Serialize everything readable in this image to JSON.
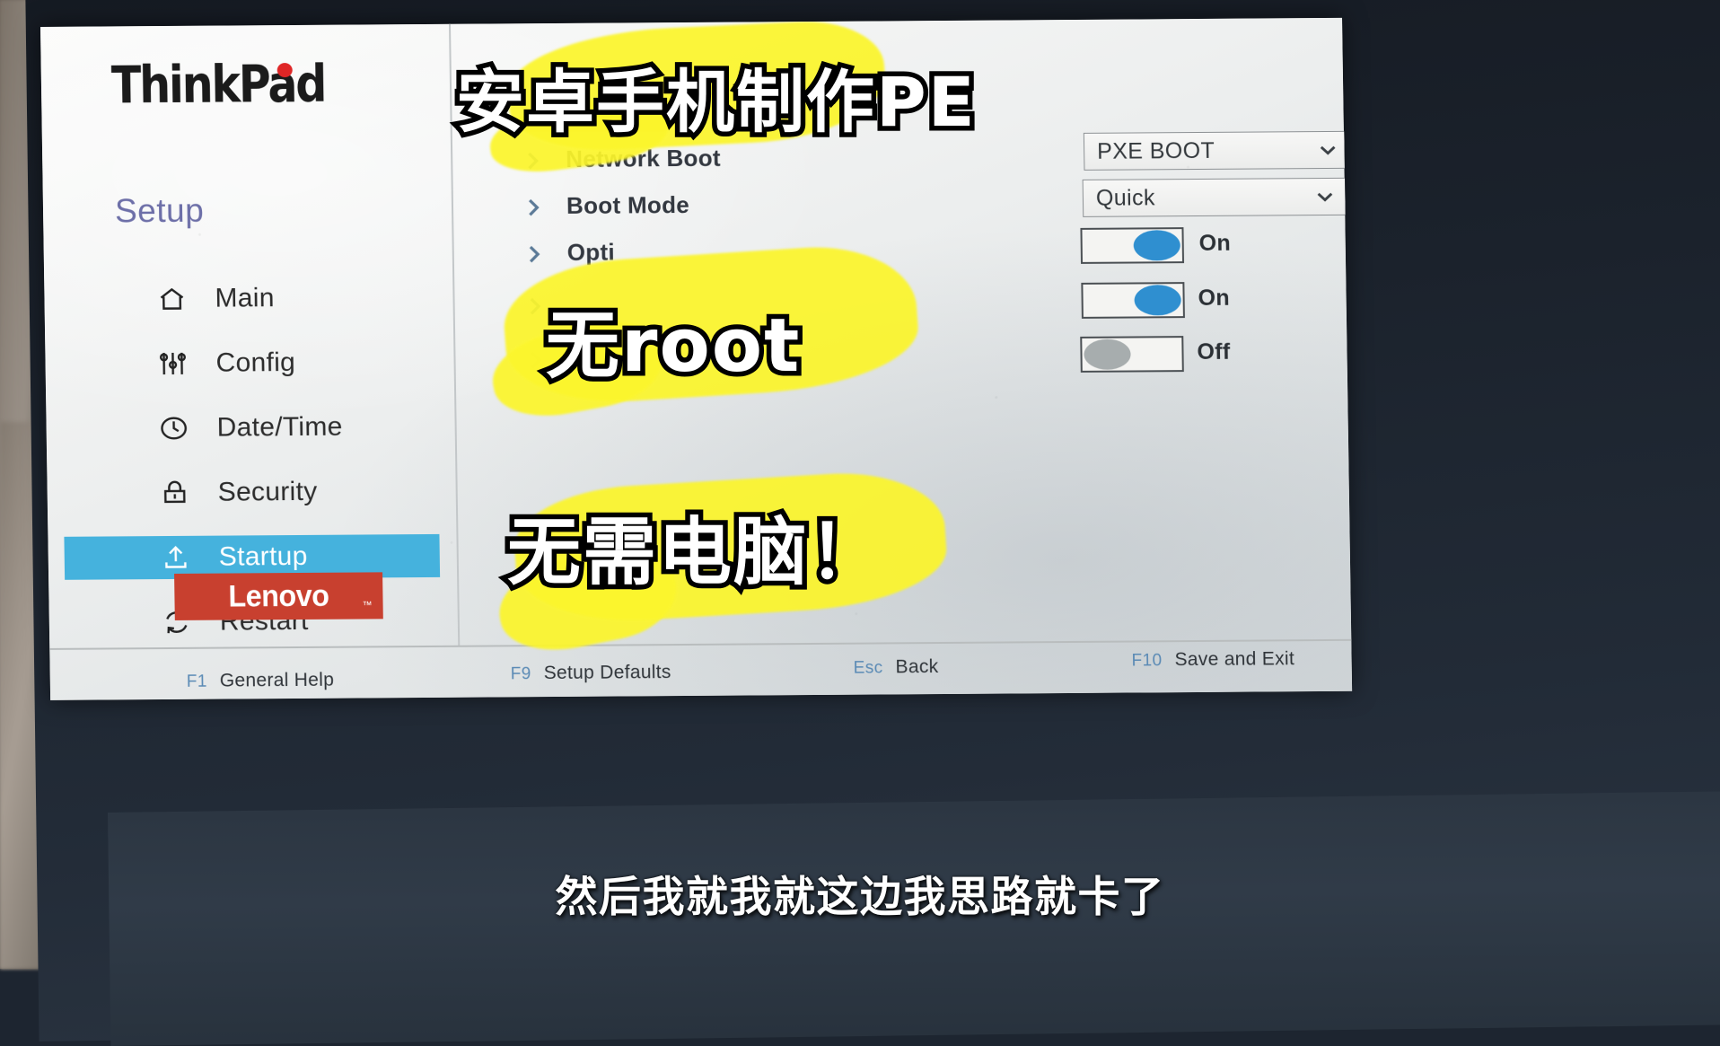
{
  "brand": {
    "thinkpad_logo": "ThinkPad",
    "lenovo_logo": "Lenovo",
    "lenovo_tm": "™",
    "accent_selected": "#45b2dd",
    "accent_lenovo_red": "#c8402f",
    "accent_toggle_on": "#2f8fd0",
    "accent_toggle_off": "#a7adae",
    "highlight_yellow": "#fbf52c"
  },
  "sidebar": {
    "title": "Setup",
    "items": [
      {
        "label": "Main",
        "icon": "home-icon",
        "selected": false
      },
      {
        "label": "Config",
        "icon": "sliders-icon",
        "selected": false
      },
      {
        "label": "Date/Time",
        "icon": "clock-icon",
        "selected": false
      },
      {
        "label": "Security",
        "icon": "lock-icon",
        "selected": false
      },
      {
        "label": "Startup",
        "icon": "upload-icon",
        "selected": true
      },
      {
        "label": "Restart",
        "icon": "refresh-icon",
        "selected": false
      }
    ]
  },
  "settings": {
    "rows": [
      {
        "label": "Network Boot",
        "control": "select",
        "value": "PXE BOOT"
      },
      {
        "label": "Boot Mode",
        "control": "select",
        "value": "Quick"
      },
      {
        "label": "Opti",
        "control": "toggle",
        "value": "On"
      },
      {
        "label": "",
        "control": "toggle",
        "value": "On"
      },
      {
        "label": "",
        "control": "toggle",
        "value": "Off"
      }
    ]
  },
  "footer": {
    "keys": [
      {
        "key": "F1",
        "desc": "General Help"
      },
      {
        "key": "F9",
        "desc": "Setup Defaults"
      },
      {
        "key": "Esc",
        "desc": "Back"
      },
      {
        "key": "F10",
        "desc": "Save and Exit"
      }
    ]
  },
  "overlay": {
    "captions": [
      "安卓手机制作PE",
      "无root",
      "无需电脑！"
    ],
    "subtitle": "然后我就我就这边我思路就卡了"
  }
}
